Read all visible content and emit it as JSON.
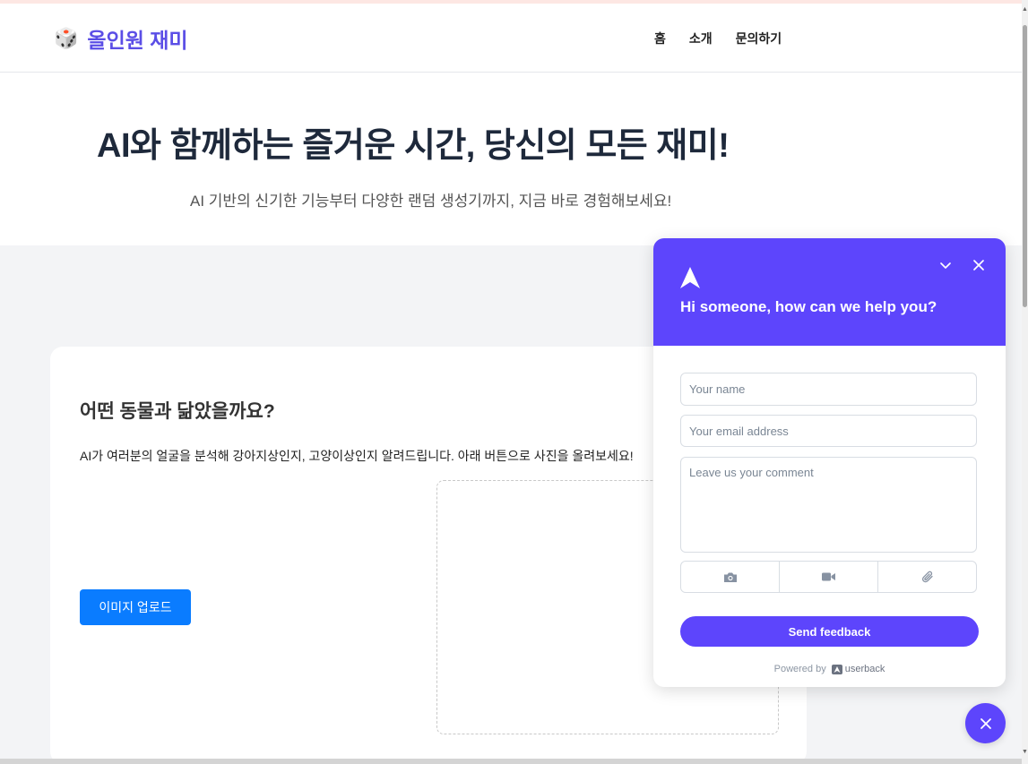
{
  "header": {
    "logo_icon": "dice-icon",
    "logo_text": "올인원 재미",
    "nav": [
      {
        "label": "홈"
      },
      {
        "label": "소개"
      },
      {
        "label": "문의하기"
      }
    ]
  },
  "hero": {
    "title": "AI와 함께하는 즐거운 시간, 당신의 모든 재미!",
    "subtitle": "AI 기반의 신기한 기능부터 다양한 랜덤 생성기까지, 지금 바로 경험해보세요!"
  },
  "card": {
    "title": "어떤 동물과 닮았을까요?",
    "description": "AI가 여러분의 얼굴을 분석해 강아지상인지, 고양이상인지 알려드립니다. 아래 버튼으로 사진을 올려보세요!",
    "upload_button": "이미지 업로드"
  },
  "feedback_widget": {
    "title": "Hi someone, how can we help you?",
    "name_placeholder": "Your name",
    "email_placeholder": "Your email address",
    "comment_placeholder": "Leave us your comment",
    "attachments": [
      "camera-icon",
      "video-icon",
      "paperclip-icon"
    ],
    "send_button": "Send feedback",
    "powered_by": "Powered by",
    "brand": "userback",
    "accent_color": "#5d45fc"
  },
  "colors": {
    "brand": "#5b4ee6",
    "upload_button": "#0a7cff"
  }
}
